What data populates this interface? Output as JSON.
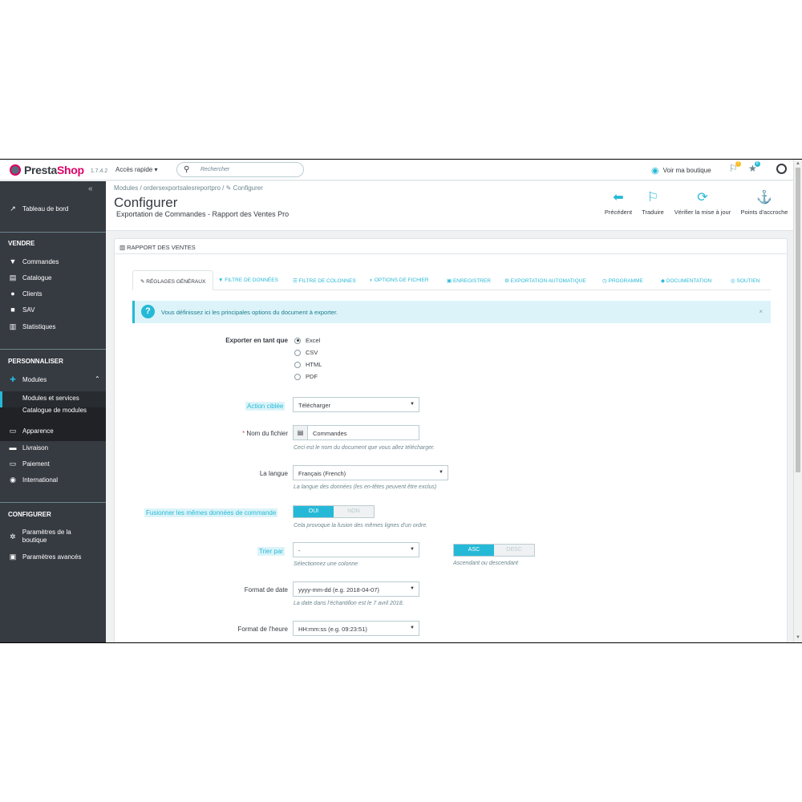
{
  "topbar": {
    "logo_presta": "Presta",
    "logo_shop": "Shop",
    "version": "1.7.4.2",
    "quick_access": "Accès rapide ▾",
    "search_placeholder": "Rechercher",
    "view_shop": "Voir ma boutique",
    "notif_orders": "7",
    "notif_customers": "8"
  },
  "sidebar": {
    "collapse": "«",
    "dashboard": "Tableau de bord",
    "section_sell": "VENDRE",
    "orders": "Commandes",
    "catalog": "Catalogue",
    "customers": "Clients",
    "service": "SAV",
    "stats": "Statistiques",
    "section_customize": "PERSONNALISER",
    "modules": "Modules",
    "modules_services": "Modules et services",
    "modules_catalog": "Catalogue de modules",
    "appearance": "Apparence",
    "shipping": "Livraison",
    "payment": "Paiement",
    "international": "International",
    "section_configure": "CONFIGURER",
    "shop_params": "Paramètres de la boutique",
    "advanced_params": "Paramètres avancés"
  },
  "header": {
    "breadcrumb": "Modules  /  ordersexportsalesreportpro  /  ✎ Configurer",
    "title": "Configurer",
    "subtitle": "Exportation de Commandes - Rapport des Ventes Pro",
    "btn_back": "Précédent",
    "btn_translate": "Traduire",
    "btn_update": "Vérifier la mise à jour",
    "btn_hooks": "Points d'accroche"
  },
  "panel": {
    "title": "RAPPORT DES VENTES",
    "tabs": [
      "✎ RÉGLAGES GÉNÉRAUX",
      "▼ FILTRE DE DONNÉES",
      "☰ FILTRE DE COLONNES",
      "◐ OPTIONS DE FICHIER",
      "▣ ENREGISTRER",
      "⚙ EXPORTATION AUTOMATIQUE",
      "◷ PROGRAMME",
      "◆ DOCUMENTATION",
      "◎ SOUTIEN"
    ],
    "alert": "Vous définissez ici les principales options du document à exporter.",
    "alert_close": "×"
  },
  "form": {
    "export_as_label": "Exporter en tant que",
    "export_options": [
      "Excel",
      "CSV",
      "HTML",
      "PDF"
    ],
    "action_label": "Action ciblée",
    "action_value": "Télécharger",
    "filename_label": "Nom du fichier",
    "filename_required": "*",
    "filename_value": "Commandes",
    "filename_help": "Ceci est le nom du document que vous allez télécharger.",
    "language_label": "La langue",
    "language_value": "Français (French)",
    "language_help": "La langue des données (les en-têtes peuvent être exclus)",
    "merge_label": "Fusionner les mêmes données de commande",
    "merge_on": "OUI",
    "merge_off": "NON",
    "merge_help": "Cela provoque la fusion des mêmes lignes d'un ordre.",
    "sort_label": "Trier par",
    "sort_value": "-",
    "sort_help": "Sélectionnez une colonne",
    "sort_asc": "ASC",
    "sort_desc": "DESC",
    "sort_dir_help": "Ascendant ou descendant",
    "date_label": "Format de date",
    "date_value": "yyyy-mm-dd (e.g. 2018-04-07)",
    "date_help": "La date dans l'échantillon est le 7 avril 2018.",
    "time_label": "Format de l'heure",
    "time_value": "HH:mm:ss (e.g. 09:23:51)"
  }
}
